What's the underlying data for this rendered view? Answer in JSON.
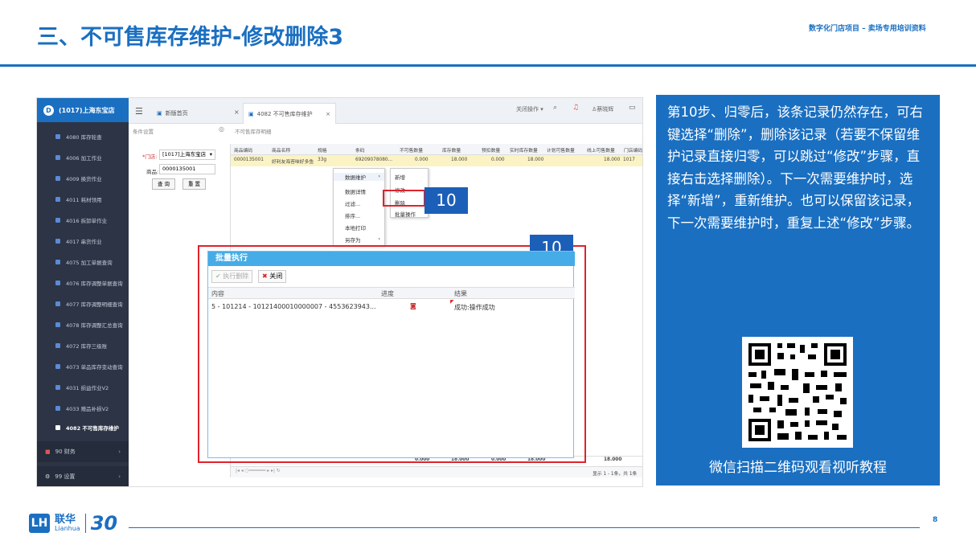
{
  "slide": {
    "title": "三、不可售库存维护-修改删除3",
    "header_right": "数字化门店项目 – 卖场专用培训资料",
    "page_number": "8"
  },
  "app": {
    "store_name": "(1017)上海东宝店",
    "sidebar_items": [
      "4080 库存轮查",
      "4006 加工作业",
      "4009 换货作业",
      "4011 耗材领用",
      "4016 拆卸单作业",
      "4017 串货作业",
      "4075 加工单据查询",
      "4076 库存调整单据查询",
      "4077 库存调整明细查询",
      "4078 库存调整汇总查询",
      "4072 库存三级账",
      "4073 单品库存变动查询",
      "4031 损益作业V2",
      "4033 赠品补损V2",
      "4082 不可售库存维护"
    ],
    "sidebar_groups": [
      "90 财务",
      "99 设置"
    ],
    "tabs": [
      "新版首页",
      "4082 不可售库存维护"
    ],
    "topbar_close_ops": "关闭操作",
    "user": "蔡晓辉",
    "cond_label": "条件设置",
    "detail_label": "不可售库存明细",
    "filter": {
      "store_label": "*门店:",
      "store_value": "[1017]上海东宝店",
      "product_label": "商品:",
      "product_value": "0000135001",
      "query_button": "查 询",
      "reset_button": "重 置"
    },
    "grid": {
      "headers": [
        "商品编码",
        "商品名称",
        "规格",
        "条码",
        "不可售数量",
        "库存数量",
        "预扣数量",
        "实时库存数量",
        "计划可售数量",
        "线上可售数量",
        "门店编码"
      ],
      "row": [
        "0000135001",
        "好利友海苔味好多鱼",
        "33g",
        "69209078080...",
        "0.000",
        "18.000",
        "0.000",
        "18.000",
        "",
        "18.000",
        "1017"
      ],
      "totals": [
        "0.000",
        "18.000",
        "0.000",
        "18.000",
        "18.000"
      ],
      "pager_text": "显示 1 - 1条，共 1条"
    },
    "context_menu": [
      "数据维护",
      "数据详情",
      "过滤...",
      "排序...",
      "本地打印",
      "另存为"
    ],
    "submenu": [
      "新增",
      "修改",
      "删除",
      "批量操作"
    ],
    "dialog": {
      "title": "批量执行",
      "exec_delete_button": "执行删除",
      "close_button": "关闭",
      "col_content": "内容",
      "col_progress": "进度",
      "col_result": "结果",
      "row_content": "5 - 101214 - 10121400010000007 - 4553623943...",
      "row_result": "成功:操作成功"
    }
  },
  "badges": [
    "10",
    "10"
  ],
  "info_text": "第10步、归零后，该条记录仍然存在，可右键选择“删除”，删除该记录（若要不保留维护记录直接归零，可以跳过“修改”步骤，直接右击选择删除）。下一次需要维护时，选择“新增”，重新维护。也可以保留该记录，下一次需要维护时，重复上述“修改”步骤。",
  "qr_caption": "微信扫描二维码观看视听教程",
  "footer": {
    "logo_cn": "联华",
    "logo_en": "Lianhua",
    "logo_anniversary": "30"
  },
  "colors": {
    "brand_blue": "#1a6fc1",
    "highlight_red": "#e0222c",
    "dialog_header": "#45ace7"
  }
}
